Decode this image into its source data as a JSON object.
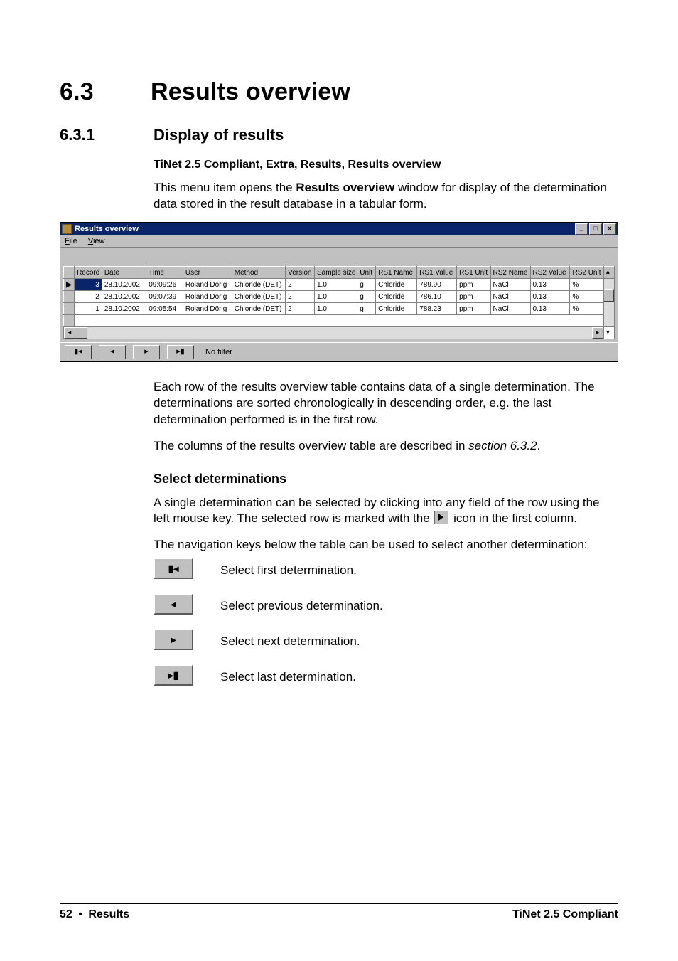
{
  "section": {
    "num": "6.3",
    "title": "Results overview"
  },
  "subsection": {
    "num": "6.3.1",
    "title": "Display of results"
  },
  "path": "TiNet 2.5 Compliant, Extra, Results, Results overview",
  "intro_a": "This menu item opens the ",
  "intro_bold": "Results overview",
  "intro_b": " window for display of the determination data stored in the result database in a tabular form.",
  "window": {
    "title": "Results overview",
    "menu": {
      "file": "File",
      "view": "View"
    },
    "headers": [
      "Record",
      "Date",
      "Time",
      "User",
      "Method",
      "Version",
      "Sample size",
      "Unit",
      "RS1 Name",
      "RS1 Value",
      "RS1 Unit",
      "RS2 Name",
      "RS2 Value",
      "RS2 Unit"
    ],
    "rows": [
      {
        "record": "3",
        "date": "28.10.2002",
        "time": "09:09:26",
        "user": "Roland Dörig",
        "method": "Chloride (DET)",
        "version": "2",
        "sample": "1.0",
        "unit": "g",
        "rs1n": "Chloride",
        "rs1v": "789.90",
        "rs1u": "ppm",
        "rs2n": "NaCl",
        "rs2v": "0.13",
        "rs2u": "%"
      },
      {
        "record": "2",
        "date": "28.10.2002",
        "time": "09:07:39",
        "user": "Roland Dörig",
        "method": "Chloride (DET)",
        "version": "2",
        "sample": "1.0",
        "unit": "g",
        "rs1n": "Chloride",
        "rs1v": "786.10",
        "rs1u": "ppm",
        "rs2n": "NaCl",
        "rs2v": "0.13",
        "rs2u": "%"
      },
      {
        "record": "1",
        "date": "28.10.2002",
        "time": "09:05:54",
        "user": "Roland Dörig",
        "method": "Chloride (DET)",
        "version": "2",
        "sample": "1.0",
        "unit": "g",
        "rs1n": "Chloride",
        "rs1v": "788.23",
        "rs1u": "ppm",
        "rs2n": "NaCl",
        "rs2v": "0.13",
        "rs2u": "%"
      }
    ],
    "nofilter": "No filter"
  },
  "para2": "Each row of the results overview table contains data of a single determination. The determinations are sorted chronologically in descending order, e.g. the last determination performed is in the first row.",
  "para3_a": "The columns of the results overview table are described in ",
  "para3_i": "section 6.3.2",
  "para3_b": ".",
  "minor_heading": "Select determinations",
  "para4_a": "A single determination can be selected by clicking into any field of the row using the left mouse key. The selected row is marked with the ",
  "para4_b": " icon in the first column.",
  "para5": "The navigation keys below the table can be used to select another determination:",
  "nav": {
    "first": "Select first determination.",
    "prev": "Select previous determination.",
    "next": "Select next determination.",
    "last": "Select last determination."
  },
  "footer": {
    "page": "52",
    "bullet": "•",
    "section": "Results",
    "right": "TiNet 2.5 Compliant"
  }
}
